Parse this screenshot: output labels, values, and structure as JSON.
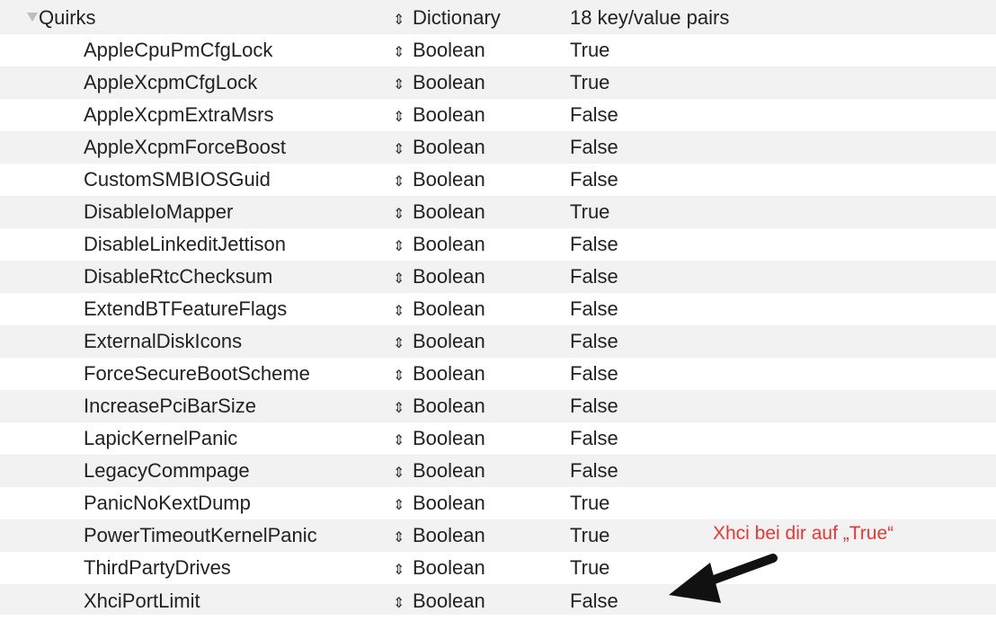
{
  "root": {
    "key": "Quirks",
    "type": "Dictionary",
    "value": "18 key/value pairs"
  },
  "rows": [
    {
      "key": "AppleCpuPmCfgLock",
      "type": "Boolean",
      "value": "True"
    },
    {
      "key": "AppleXcpmCfgLock",
      "type": "Boolean",
      "value": "True"
    },
    {
      "key": "AppleXcpmExtraMsrs",
      "type": "Boolean",
      "value": "False"
    },
    {
      "key": "AppleXcpmForceBoost",
      "type": "Boolean",
      "value": "False"
    },
    {
      "key": "CustomSMBIOSGuid",
      "type": "Boolean",
      "value": "False"
    },
    {
      "key": "DisableIoMapper",
      "type": "Boolean",
      "value": "True"
    },
    {
      "key": "DisableLinkeditJettison",
      "type": "Boolean",
      "value": "False"
    },
    {
      "key": "DisableRtcChecksum",
      "type": "Boolean",
      "value": "False"
    },
    {
      "key": "ExtendBTFeatureFlags",
      "type": "Boolean",
      "value": "False"
    },
    {
      "key": "ExternalDiskIcons",
      "type": "Boolean",
      "value": "False"
    },
    {
      "key": "ForceSecureBootScheme",
      "type": "Boolean",
      "value": "False"
    },
    {
      "key": "IncreasePciBarSize",
      "type": "Boolean",
      "value": "False"
    },
    {
      "key": "LapicKernelPanic",
      "type": "Boolean",
      "value": "False"
    },
    {
      "key": "LegacyCommpage",
      "type": "Boolean",
      "value": "False"
    },
    {
      "key": "PanicNoKextDump",
      "type": "Boolean",
      "value": "True"
    },
    {
      "key": "PowerTimeoutKernelPanic",
      "type": "Boolean",
      "value": "True"
    },
    {
      "key": "ThirdPartyDrives",
      "type": "Boolean",
      "value": "True"
    },
    {
      "key": "XhciPortLimit",
      "type": "Boolean",
      "value": "False"
    }
  ],
  "icons": {
    "disclosure": "disclosure-triangle-icon",
    "type_popup": "up-down-arrows-icon",
    "annotation_arrow": "arrow-icon"
  },
  "annotation": {
    "text": "Xhci  bei dir auf „True“",
    "color": "#e53935"
  },
  "colors": {
    "row_alt": "#f2f2f2",
    "text": "#222222",
    "arrow": "#111111"
  }
}
